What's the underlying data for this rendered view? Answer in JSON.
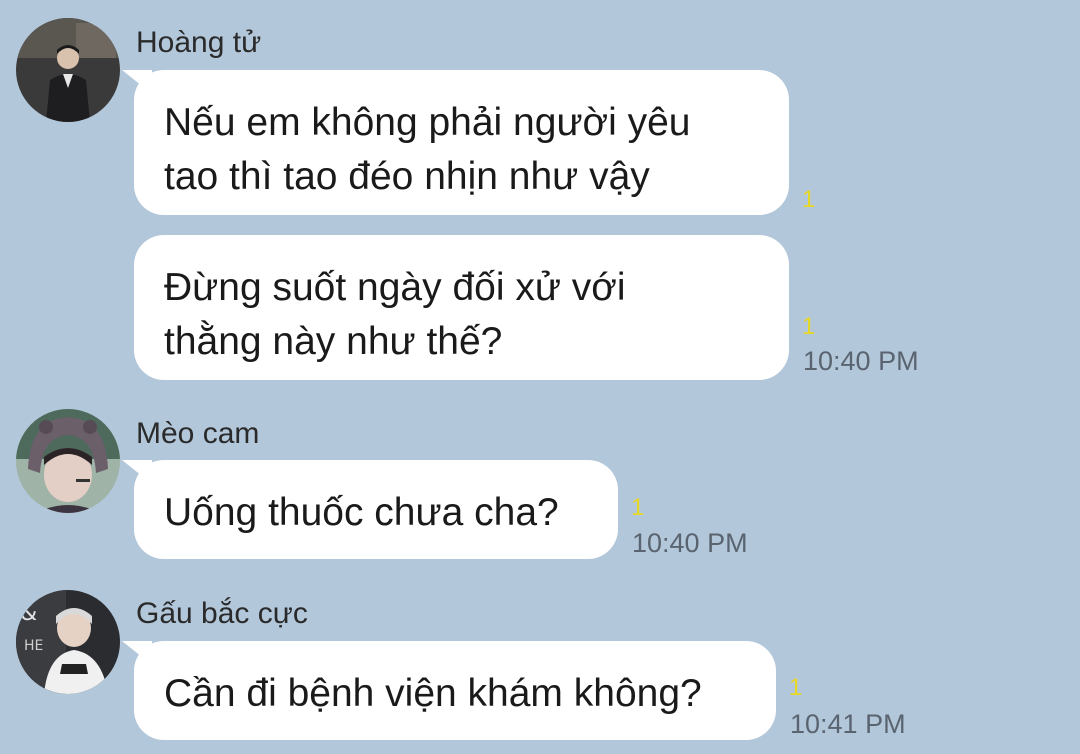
{
  "messages": [
    {
      "sender": "Hoàng tử",
      "bubbles": [
        {
          "text": "Nếu em không phải người yêu\ntao thì tao đéo nhịn như vậy",
          "unread": "1"
        },
        {
          "text": "Đừng suốt ngày đối xử với\nthằng này như thế?",
          "unread": "1",
          "time": "10:40 PM"
        }
      ]
    },
    {
      "sender": "Mèo cam",
      "bubbles": [
        {
          "text": "Uống thuốc chưa cha?",
          "unread": "1",
          "time": "10:40 PM"
        }
      ]
    },
    {
      "sender": "Gấu bắc cực",
      "bubbles": [
        {
          "text": "Cần đi bệnh viện khám không?",
          "unread": "1",
          "time": "10:41 PM"
        }
      ]
    }
  ]
}
